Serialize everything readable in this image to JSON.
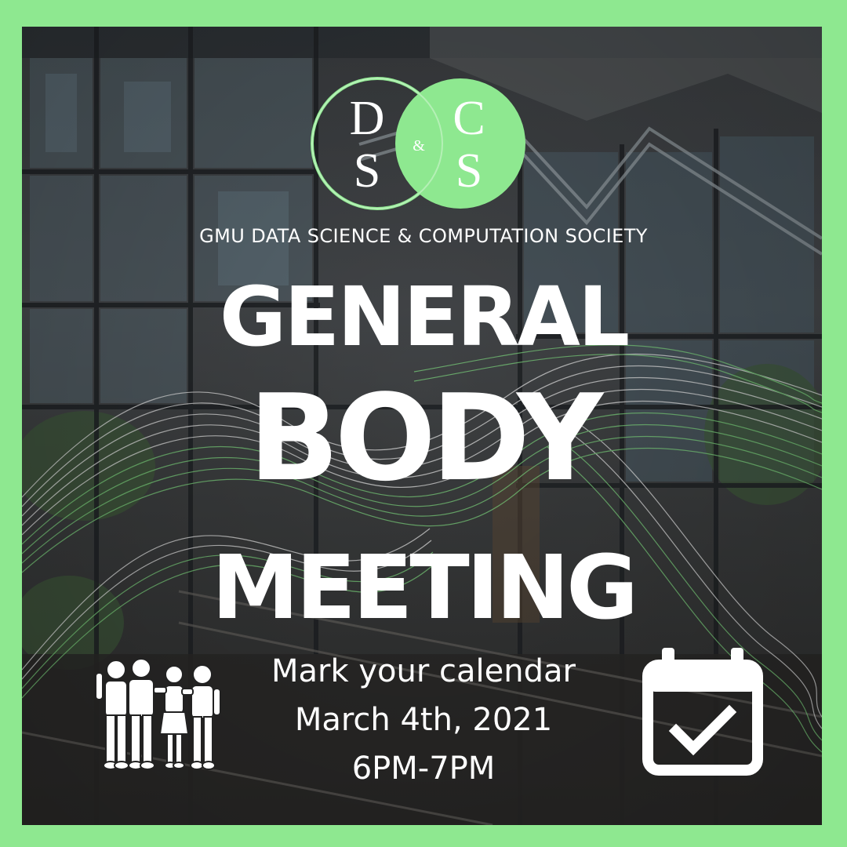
{
  "logo": {
    "letters": [
      "D",
      "C",
      "S",
      "S"
    ],
    "ampersand": "&",
    "colors": {
      "accent": "#8ee890",
      "outline": "#8ee890"
    }
  },
  "society_name": "GMU DATA SCIENCE & COMPUTATION SOCIETY",
  "headline": {
    "line1": "GENERAL",
    "line2": "BODY",
    "line3": "MEETING"
  },
  "details": {
    "tagline": "Mark your calendar",
    "date": "March 4th, 2021",
    "time": "6PM-7PM"
  },
  "icons": {
    "people": "group-of-people-icon",
    "calendar": "calendar-check-icon"
  },
  "colors": {
    "border": "#8ee890",
    "text": "#ffffff",
    "wave_green": "#7ed67f",
    "wave_white": "#e8e8e8"
  }
}
